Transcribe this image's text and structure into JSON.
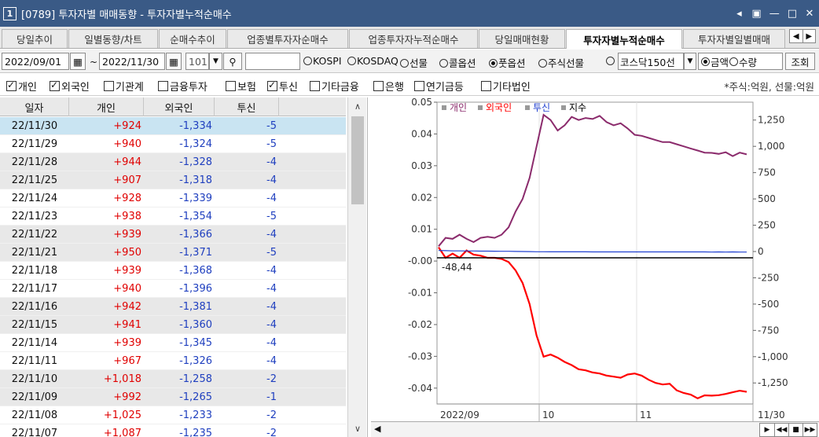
{
  "window": {
    "number": "1",
    "title": "[0789] 투자자별 매매동향 - 투자자별누적순매수",
    "controls": [
      "◂",
      "▣",
      "—",
      "□",
      "✕"
    ]
  },
  "tabs": [
    {
      "label": "당일추이",
      "active": false
    },
    {
      "label": "일별동향/차트",
      "active": false
    },
    {
      "label": "순매수추이",
      "active": false
    },
    {
      "label": "업종별투자자순매수",
      "active": false
    },
    {
      "label": "업종투자자누적순매수",
      "active": false
    },
    {
      "label": "당일매매현황",
      "active": false
    },
    {
      "label": "투자자별누적순매수",
      "active": true
    },
    {
      "label": "투자자별일별매매",
      "active": false
    }
  ],
  "toolbar": {
    "start_date": "2022/09/01",
    "tilde": "~",
    "end_date": "2022/11/30",
    "count": "101",
    "code_value": "",
    "radio_options": [
      {
        "label": "KOSPI",
        "on": false
      },
      {
        "label": "KOSDAQ",
        "on": false
      },
      {
        "label": "선물",
        "on": false
      },
      {
        "label": "콜옵션",
        "on": false
      },
      {
        "label": "풋옵션",
        "on": true
      },
      {
        "label": "주식선물",
        "on": false
      },
      {
        "label": "",
        "on": false
      }
    ],
    "kosdaq150_label": "코스닥150선",
    "unit_options": [
      {
        "label": "금액",
        "on": true
      },
      {
        "label": "수량",
        "on": false
      }
    ],
    "query_button": "조회"
  },
  "filters": {
    "items": [
      {
        "label": "개인",
        "checked": true
      },
      {
        "label": "외국인",
        "checked": true
      },
      {
        "label": "기관계",
        "checked": false
      },
      {
        "label": "금융투자",
        "checked": false
      },
      {
        "label": "보험",
        "checked": false
      },
      {
        "label": "투신",
        "checked": true
      },
      {
        "label": "기타금융",
        "checked": false
      },
      {
        "label": "은행",
        "checked": false
      },
      {
        "label": "연기금등",
        "checked": false
      },
      {
        "label": "기타법인",
        "checked": false
      }
    ],
    "unit_note": "*주식:억원, 선물:억원"
  },
  "table": {
    "headers": [
      "일자",
      "개인",
      "외국인",
      "투신",
      ""
    ],
    "rows": [
      [
        "22/11/30",
        "+924",
        "-1,334",
        "-5"
      ],
      [
        "22/11/29",
        "+940",
        "-1,324",
        "-5"
      ],
      [
        "22/11/28",
        "+944",
        "-1,328",
        "-4"
      ],
      [
        "22/11/25",
        "+907",
        "-1,318",
        "-4"
      ],
      [
        "22/11/24",
        "+928",
        "-1,339",
        "-4"
      ],
      [
        "22/11/23",
        "+938",
        "-1,354",
        "-5"
      ],
      [
        "22/11/22",
        "+939",
        "-1,366",
        "-4"
      ],
      [
        "22/11/21",
        "+950",
        "-1,371",
        "-5"
      ],
      [
        "22/11/18",
        "+939",
        "-1,368",
        "-4"
      ],
      [
        "22/11/17",
        "+940",
        "-1,396",
        "-4"
      ],
      [
        "22/11/16",
        "+942",
        "-1,381",
        "-4"
      ],
      [
        "22/11/15",
        "+941",
        "-1,360",
        "-4"
      ],
      [
        "22/11/14",
        "+939",
        "-1,345",
        "-4"
      ],
      [
        "22/11/11",
        "+967",
        "-1,326",
        "-4"
      ],
      [
        "22/11/10",
        "+1,018",
        "-1,258",
        "-2"
      ],
      [
        "22/11/09",
        "+992",
        "-1,265",
        "-1"
      ],
      [
        "22/11/08",
        "+1,025",
        "-1,233",
        "-2"
      ],
      [
        "22/11/07",
        "+1,087",
        "-1,235",
        "-2"
      ]
    ],
    "selected_row": 0
  },
  "chart_data": {
    "type": "line",
    "legend": [
      {
        "name": "개인",
        "color": "#8b2b6c"
      },
      {
        "name": "외국인",
        "color": "#ff0000"
      },
      {
        "name": "투신",
        "color": "#2040d0"
      },
      {
        "name": "지수",
        "color": "#000000"
      }
    ],
    "left_axis": {
      "ticks": [
        "0.05",
        "0.04",
        "0.03",
        "0.02",
        "0.01",
        "-0.00",
        "-0.01",
        "-0.02",
        "-0.03",
        "-0.04"
      ],
      "range": [
        -0.045,
        0.05
      ]
    },
    "right_axis": {
      "ticks": [
        "1,250",
        "1,000",
        "750",
        "500",
        "250",
        "0",
        "-250",
        "-500",
        "-750",
        "-1,000",
        "-1,250"
      ],
      "range": [
        -1450,
        1420
      ]
    },
    "x_labels": [
      "2022/09",
      "10",
      "11",
      "11/30"
    ],
    "index_annotation": "-48,44",
    "series": [
      {
        "name": "개인",
        "values": [
          50,
          130,
          120,
          160,
          120,
          90,
          130,
          140,
          130,
          160,
          230,
          380,
          500,
          700,
          1000,
          1300,
          1250,
          1150,
          1200,
          1280,
          1250,
          1270,
          1260,
          1290,
          1230,
          1200,
          1220,
          1170,
          1110,
          1100,
          1080,
          1060,
          1040,
          1040,
          1020,
          1000,
          980,
          960,
          940,
          938,
          928,
          944,
          907,
          940,
          924
        ]
      },
      {
        "name": "외국인",
        "values": [
          40,
          -60,
          -20,
          -60,
          10,
          -30,
          -40,
          -60,
          -60,
          -70,
          -100,
          -180,
          -300,
          -500,
          -800,
          -1000,
          -980,
          -1010,
          -1050,
          -1080,
          -1120,
          -1130,
          -1150,
          -1160,
          -1180,
          -1190,
          -1200,
          -1170,
          -1160,
          -1180,
          -1220,
          -1250,
          -1265,
          -1258,
          -1320,
          -1345,
          -1360,
          -1396,
          -1368,
          -1371,
          -1366,
          -1354,
          -1339,
          -1324,
          -1334
        ]
      },
      {
        "name": "투신",
        "values": [
          10,
          8,
          6,
          6,
          5,
          5,
          4,
          4,
          3,
          2,
          2,
          1,
          0,
          -1,
          -2,
          -2,
          -3,
          -3,
          -3,
          -3,
          -3,
          -3,
          -4,
          -4,
          -4,
          -4,
          -4,
          -4,
          -4,
          -4,
          -4,
          -4,
          -4,
          -4,
          -4,
          -4,
          -4,
          -4,
          -4,
          -5,
          -4,
          -5,
          -4,
          -5,
          -5
        ]
      },
      {
        "name": "지수",
        "values": [
          -48,
          -48,
          -48,
          -48,
          -48,
          -48,
          -48,
          -48,
          -48,
          -48,
          -48,
          -48,
          -48,
          -48,
          -48,
          -48,
          -48,
          -48,
          -48,
          -48,
          -48,
          -48,
          -48,
          -48,
          -48,
          -48,
          -48,
          -48,
          -48,
          -48,
          -48,
          -48,
          -48,
          -48,
          -48,
          -48,
          -48,
          -48,
          -48,
          -48,
          -48,
          -48,
          -48,
          -48,
          -48
        ]
      }
    ]
  }
}
